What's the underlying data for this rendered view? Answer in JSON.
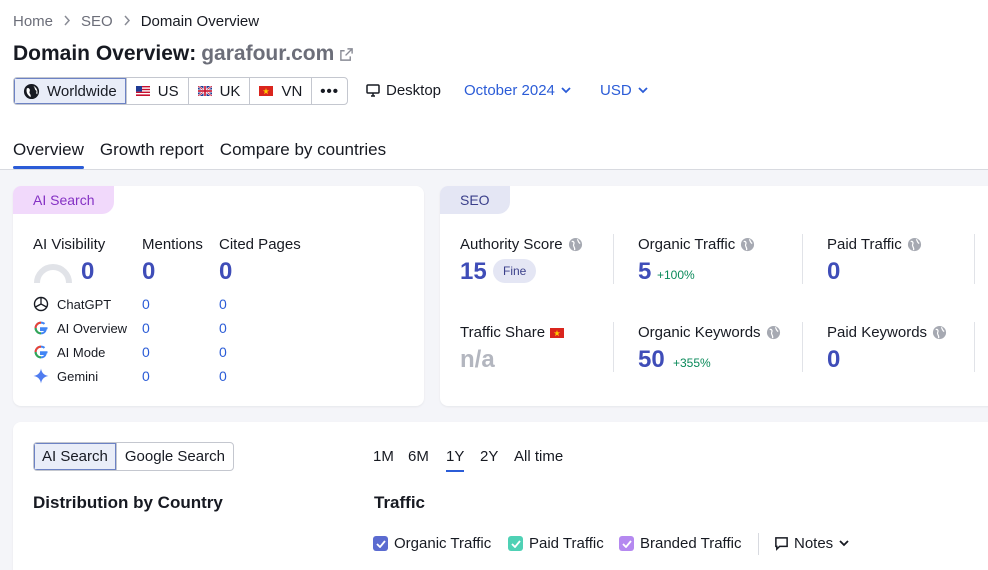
{
  "breadcrumb": [
    "Home",
    "SEO",
    "Domain Overview"
  ],
  "title": {
    "prefix": "Domain Overview:",
    "domain": "garafour.com"
  },
  "databases": [
    {
      "label": "Worldwide",
      "icon": "globe-icon",
      "active": true
    },
    {
      "label": "US",
      "icon": "us-flag-icon"
    },
    {
      "label": "UK",
      "icon": "uk-flag-icon"
    },
    {
      "label": "VN",
      "icon": "vn-flag-icon"
    }
  ],
  "more_label": "•••",
  "device": "Desktop",
  "date": "October 2024",
  "currency": "USD",
  "tabs": [
    "Overview",
    "Growth report",
    "Compare by countries"
  ],
  "ai_card": {
    "tag": "AI Search",
    "visibility_label": "AI Visibility",
    "visibility_value": "0",
    "mentions_label": "Mentions",
    "mentions_value": "0",
    "cited_label": "Cited Pages",
    "cited_value": "0",
    "engines": [
      {
        "name": "ChatGPT",
        "mentions": "0",
        "cited": "0"
      },
      {
        "name": "AI Overview",
        "mentions": "0",
        "cited": "0"
      },
      {
        "name": "AI Mode",
        "mentions": "0",
        "cited": "0"
      },
      {
        "name": "Gemini",
        "mentions": "0",
        "cited": "0"
      }
    ]
  },
  "seo_card": {
    "tag": "SEO",
    "authority_label": "Authority Score",
    "authority_value": "15",
    "authority_badge": "Fine",
    "organic_traffic_label": "Organic Traffic",
    "organic_traffic_value": "5",
    "organic_traffic_delta": "+100%",
    "paid_traffic_label": "Paid Traffic",
    "paid_traffic_value": "0",
    "traffic_share_label": "Traffic Share",
    "traffic_share_value": "n/a",
    "organic_keywords_label": "Organic Keywords",
    "organic_keywords_value": "50",
    "organic_keywords_delta": "+355%",
    "paid_keywords_label": "Paid Keywords",
    "paid_keywords_value": "0"
  },
  "bottom": {
    "search_toggle": [
      "AI Search",
      "Google Search"
    ],
    "periods": [
      "1M",
      "6M",
      "1Y",
      "2Y",
      "All time"
    ],
    "active_period": "1Y",
    "distribution_title": "Distribution by Country",
    "traffic_title": "Traffic",
    "legend": [
      {
        "label": "Organic Traffic",
        "color": "#5b6bd0"
      },
      {
        "label": "Paid Traffic",
        "color": "#4fd1b5"
      },
      {
        "label": "Branded Traffic",
        "color": "#b589f0"
      }
    ],
    "notes_label": "Notes"
  }
}
